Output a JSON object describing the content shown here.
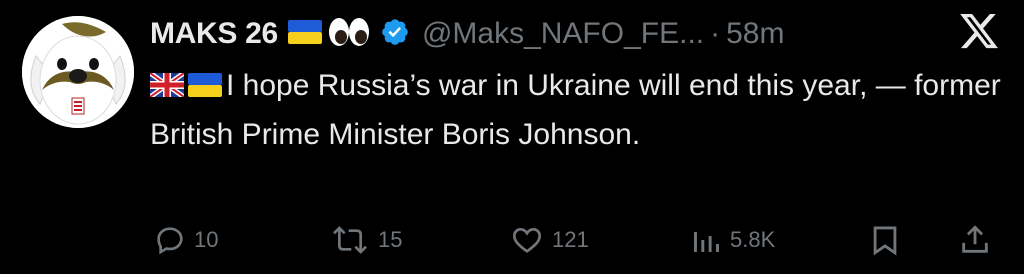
{
  "post": {
    "display_name": "MAKS 26",
    "handle": "@Maks_NAFO_FE...",
    "separator": "·",
    "time": "58m",
    "verified": true,
    "name_emojis": [
      "ukraine-flag",
      "eyes"
    ],
    "text_flags": [
      "uk-flag",
      "ukraine-flag"
    ],
    "text": "I hope Russia’s war in Ukraine will end this year, — former British Prime Minister Boris Johnson."
  },
  "actions": {
    "replies": "10",
    "reposts": "15",
    "likes": "121",
    "views": "5.8K"
  },
  "icons": [
    "x-logo",
    "reply-icon",
    "repost-icon",
    "like-icon",
    "views-icon",
    "bookmark-icon",
    "share-icon"
  ],
  "colors": {
    "background": "#000000",
    "text": "#e7e9ea",
    "muted": "#71767b",
    "verified": "#1d9bf0"
  }
}
